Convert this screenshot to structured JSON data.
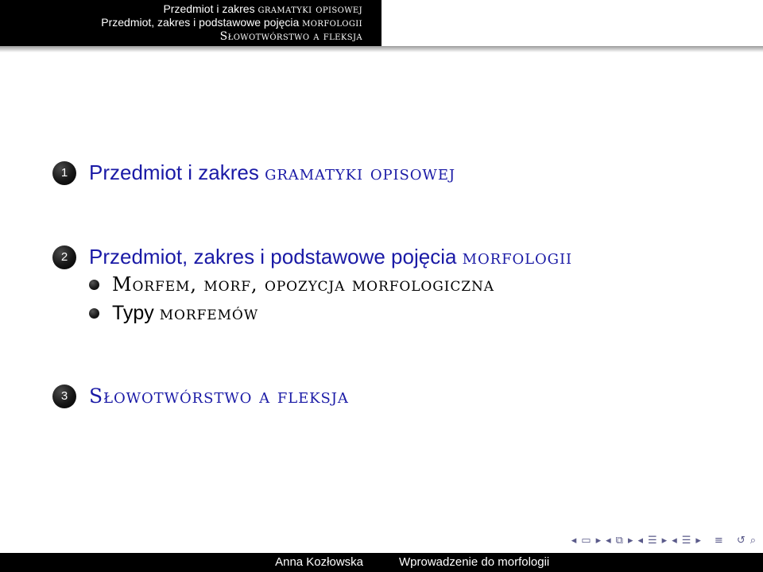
{
  "header": {
    "line1_plain": "Przedmiot i zakres ",
    "line1_sc": "gramatyki opisowej",
    "line2_plain": "Przedmiot, zakres i podstawowe pojęcia ",
    "line2_sc": "morfologii",
    "line3_sc": "Słowotwórstwo a fleksja"
  },
  "toc": {
    "sections": [
      {
        "number": "1",
        "title_plain": "Przedmiot i zakres ",
        "title_sc": "gramatyki opisowej"
      },
      {
        "number": "2",
        "title_plain": "Przedmiot, zakres i podstawowe pojęcia ",
        "title_sc": "morfologii",
        "subsections": [
          {
            "title_plain": "",
            "title_sc": "Morfem, morf, opozycja morfologiczna"
          },
          {
            "title_plain": "Typy ",
            "title_sc": "morfemów"
          }
        ]
      },
      {
        "number": "3",
        "title_plain": "",
        "title_sc": "Słowotwórstwo a fleksja"
      }
    ]
  },
  "navigation": {
    "icons": [
      "nav-left-arrow-icon",
      "slide-icon",
      "nav-right-arrow-icon",
      "nav-left-arrow-icon",
      "frame-icon",
      "nav-right-arrow-icon",
      "nav-left-arrow-icon",
      "subsection-icon",
      "nav-right-arrow-icon",
      "nav-left-arrow-icon",
      "section-icon",
      "nav-right-arrow-icon",
      "outline-icon",
      "back-icon",
      "search-icon"
    ]
  },
  "footer": {
    "author": "Anna Kozłowska",
    "title": "Wprowadzenie do morfologii"
  },
  "colors": {
    "accent": "#1a1aa6",
    "bars": "#000000"
  }
}
